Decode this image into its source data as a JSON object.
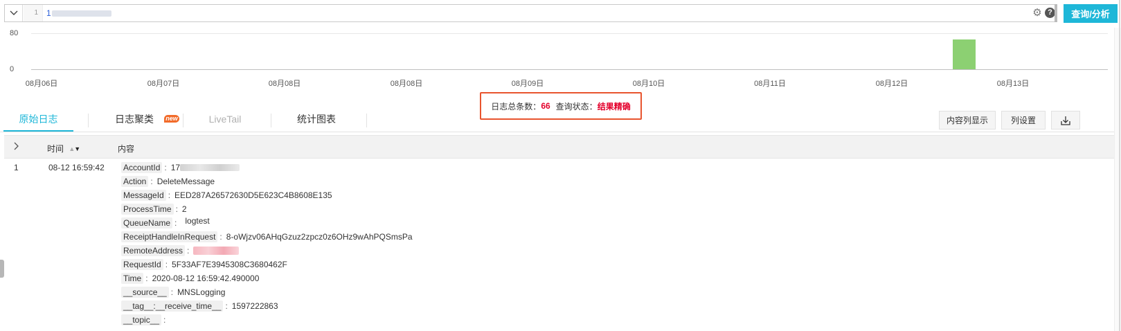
{
  "query": {
    "line_number": "1",
    "text": "1",
    "search_button_label": "查询/分析"
  },
  "histogram": {
    "y_ticks": [
      "80",
      "0"
    ],
    "x_ticks": [
      "08月06日",
      "08月07日",
      "08月08日",
      "08月08日",
      "08月09日",
      "08月10日",
      "08月11日",
      "08月12日",
      "08月13日"
    ],
    "bars": [
      {
        "value": 66
      }
    ],
    "bar_color": "#8cd072"
  },
  "status": {
    "total_label": "日志总条数：",
    "total_count": "66",
    "state_label": "查询状态：",
    "state_value": "结果精确"
  },
  "tabs": [
    {
      "label": "原始日志",
      "active": true
    },
    {
      "label": "日志聚类",
      "badge": "new"
    },
    {
      "label": "LiveTail",
      "disabled": true
    },
    {
      "label": "统计图表"
    }
  ],
  "toolbar": {
    "content_column_label": "内容列显示",
    "column_settings_label": "列设置",
    "download_icon": "download-icon"
  },
  "table": {
    "headers": {
      "time": "时间",
      "content": "内容"
    },
    "rows": [
      {
        "index": "1",
        "time": "08-12 16:59:42",
        "fields": [
          {
            "key": "AccountId",
            "value": "17"
          },
          {
            "key": "Action",
            "value": "DeleteMessage"
          },
          {
            "key": "MessageId",
            "value": "EED287A26572630D5E623C4B8608E135"
          },
          {
            "key": "ProcessTime",
            "value": "2"
          },
          {
            "key": "QueueName",
            "value": "logtest"
          },
          {
            "key": "ReceiptHandleInRequest",
            "value": "8-oWjzv06AHqGzuz2zpcz0z6OHz9wAhPQSmsPa"
          },
          {
            "key": "RemoteAddress",
            "value": ""
          },
          {
            "key": "RequestId",
            "value": "5F33AF7E3945308C3680462F"
          },
          {
            "key": "Time",
            "value": "2020-08-12 16:59:42.490000"
          },
          {
            "key": "__source__",
            "value": "MNSLogging"
          },
          {
            "key": "__tag__:__receive_time__",
            "value": "1597222863"
          },
          {
            "key": "__topic__",
            "value": ""
          }
        ]
      }
    ]
  },
  "colors": {
    "accent": "#1eb7d8",
    "highlight_border": "#e8542e",
    "status_red": "#e4002b"
  }
}
